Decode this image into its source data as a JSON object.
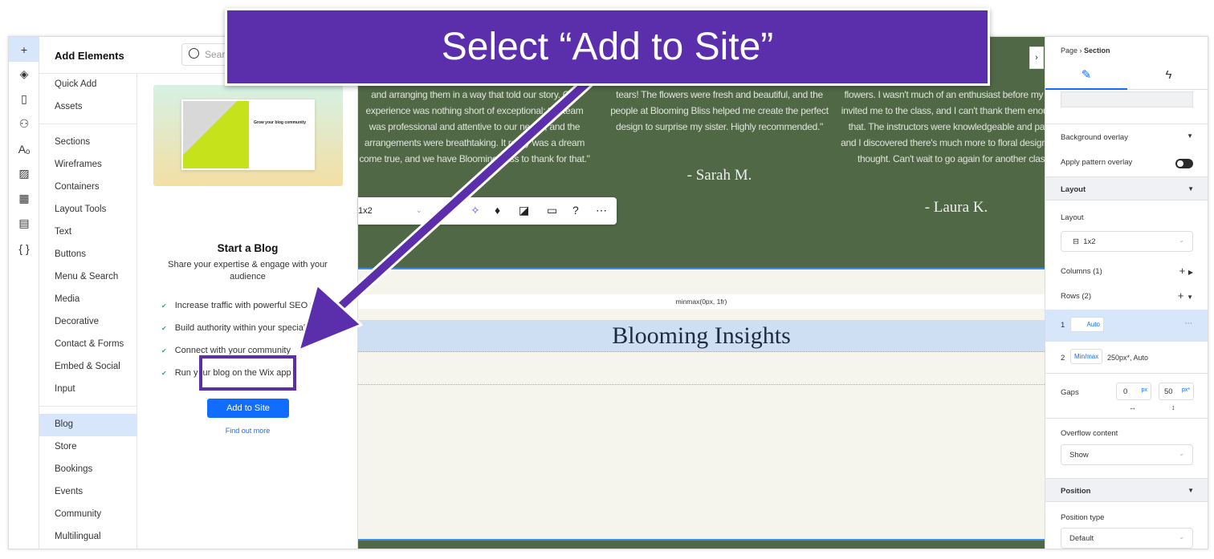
{
  "rail": {
    "icons": [
      "plus-icon",
      "layers-icon",
      "page-icon",
      "apps-icon",
      "text-theme-icon",
      "media-icon",
      "grid-apps-icon",
      "table-icon",
      "code-braces-icon"
    ],
    "glyphs": [
      "+",
      "◈",
      "▯",
      "⚇",
      "Aₒ",
      "▨",
      "▦",
      "▤",
      "{ }"
    ]
  },
  "panel": {
    "title": "Add Elements",
    "search_placeholder": "Search",
    "categories_top": [
      "Quick Add",
      "Assets"
    ],
    "categories": [
      "Sections",
      "Wireframes",
      "Containers",
      "Layout Tools",
      "Text",
      "Buttons",
      "Menu & Search",
      "Media",
      "Decorative",
      "Contact & Forms",
      "Embed & Social",
      "Input"
    ],
    "categories_apps": [
      "Blog",
      "Store",
      "Bookings",
      "Events",
      "Community",
      "Multilingual"
    ],
    "selected": "Blog",
    "blog": {
      "card_text": "Grow your blog community",
      "title": "Start a Blog",
      "description": "Share your expertise & engage with your audience",
      "features": [
        "Increase traffic with powerful SEO tools",
        "Build authority within your specialty",
        "Connect with your community",
        "Run your blog on the Wix app"
      ],
      "add_button": "Add to Site",
      "find_out_more": "Find out more"
    }
  },
  "canvas": {
    "quotes": [
      "and arranging them in a way that told our story. Our experience was nothing short of exceptional; the team was professional and attentive to our needs, and the arrangements were breathtaking. It really was a dream come true, and we have Blooming Bliss to thank for that.\"",
      "tears! The flowers were fresh and beautiful, and the people at Blooming Bliss helped me create the perfect design to surprise my sister. Highly recommended.\"",
      "flowers. I wasn't much of an enthusiast before my friend invited me to the class, and I can't thank them enough for that. The instructors were knowledgeable and patient, and I discovered there's much more to floral design than I thought. Can't wait to go again for another class.\""
    ],
    "authors": [
      "- Sarah M.",
      "- Laura K."
    ],
    "toolbar": {
      "layout": "1x2"
    },
    "grid_label": "minmax(0px, 1fr)",
    "section_title": "Blooming Insights"
  },
  "right": {
    "breadcrumb": [
      "Page",
      "Section"
    ],
    "background_overlay": "Background overlay",
    "apply_pattern": "Apply pattern overlay",
    "apply_pattern_on": false,
    "layout_header": "Layout",
    "layout_label": "Layout",
    "layout_value": "1x2",
    "columns": "Columns (1)",
    "rows": "Rows (2)",
    "row1": {
      "num": "1",
      "type": "Auto"
    },
    "row2": {
      "num": "2",
      "type": "Min/max",
      "value": "250px*, Auto"
    },
    "gaps": "Gaps",
    "gap_h": "0",
    "gap_h_unit": "px",
    "gap_v": "50",
    "gap_v_unit": "px*",
    "overflow": "Overflow content",
    "overflow_value": "Show",
    "position_header": "Position",
    "position_type": "Position type",
    "position_value": "Default"
  },
  "overlay": {
    "instruction": "Select “Add to Site”",
    "color": "#5b2fac"
  },
  "colors": {
    "accent": "#116dff",
    "section_green": "#506845"
  }
}
